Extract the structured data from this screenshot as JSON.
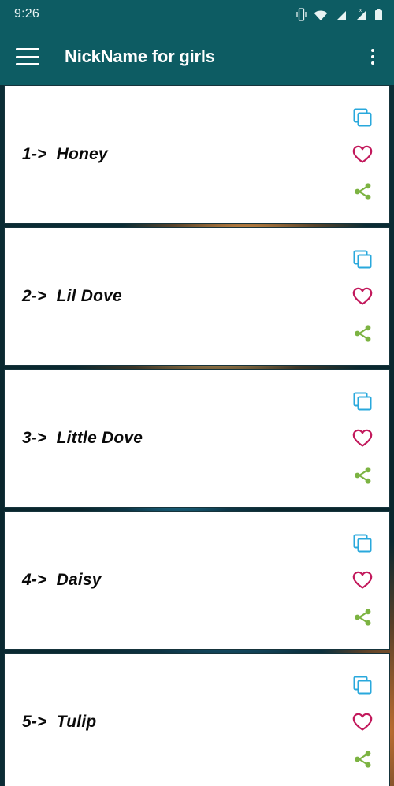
{
  "status_bar": {
    "time": "9:26",
    "icons": [
      "vibrate-icon",
      "wifi-icon",
      "signal-icon",
      "signal-x-icon",
      "battery-icon"
    ]
  },
  "app_bar": {
    "menu_icon": "hamburger-menu-icon",
    "title": "NickName for girls",
    "overflow_icon": "overflow-menu-icon"
  },
  "colors": {
    "app_bar": "#0d5c63",
    "card": "#ffffff",
    "copy_icon": "#29a8dc",
    "favorite_icon": "#c2185b",
    "share_icon": "#7cb342",
    "text": "#0a0a0a"
  },
  "list": {
    "actions": {
      "copy_label": "copy-icon",
      "favorite_label": "heart-icon",
      "share_label": "share-icon"
    },
    "items": [
      {
        "index": "1-> ",
        "name": "Honey",
        "text": "1->  Honey"
      },
      {
        "index": "2-> ",
        "name": "Lil Dove",
        "text": "2->  Lil Dove"
      },
      {
        "index": "3-> ",
        "name": "Little Dove",
        "text": "3->  Little Dove"
      },
      {
        "index": "4-> ",
        "name": "Daisy",
        "text": "4->  Daisy"
      },
      {
        "index": "5-> ",
        "name": "Tulip",
        "text": "5->  Tulip"
      }
    ]
  }
}
